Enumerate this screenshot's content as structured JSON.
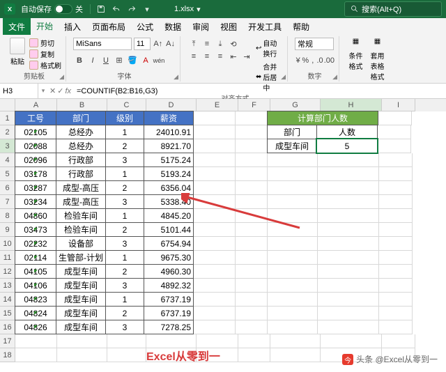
{
  "titlebar": {
    "autosave_label": "自动保存",
    "autosave_state": "关",
    "filename": "1.xlsx",
    "search_placeholder": "搜索(Alt+Q)"
  },
  "menu": {
    "file": "文件",
    "home": "开始",
    "insert": "插入",
    "layout": "页面布局",
    "formula": "公式",
    "data": "数据",
    "review": "审阅",
    "view": "视图",
    "developer": "开发工具",
    "help": "帮助"
  },
  "ribbon": {
    "paste": "粘贴",
    "cut": "剪切",
    "copy": "复制",
    "format_painter": "格式刷",
    "clipboard": "剪贴板",
    "font_name": "MiSans",
    "font_size": "11",
    "font_group": "字体",
    "align_group": "对齐方式",
    "wrap": "自动换行",
    "merge": "合并后居中",
    "number_format": "常规",
    "number_group": "数字",
    "cond_format": "条件格式",
    "table_format": "套用\n表格格式"
  },
  "cellref": {
    "name": "H3",
    "formula": "=COUNTIF(B2:B16,G3)"
  },
  "columns": [
    "A",
    "B",
    "C",
    "D",
    "E",
    "F",
    "G",
    "H",
    "I"
  ],
  "main_headers": {
    "id": "工号",
    "dept": "部门",
    "level": "级别",
    "salary": "薪资"
  },
  "side": {
    "title": "计算部门人数",
    "dept_label": "部门",
    "count_label": "人数",
    "dept_value": "成型车间",
    "count_value": "5"
  },
  "rows": [
    {
      "id": "02105",
      "dept": "总经办",
      "level": "1",
      "salary": "24010.91"
    },
    {
      "id": "02088",
      "dept": "总经办",
      "level": "2",
      "salary": "8921.70"
    },
    {
      "id": "02096",
      "dept": "行政部",
      "level": "3",
      "salary": "5175.24"
    },
    {
      "id": "03178",
      "dept": "行政部",
      "level": "1",
      "salary": "5193.24"
    },
    {
      "id": "03287",
      "dept": "成型-高压",
      "level": "2",
      "salary": "6356.04"
    },
    {
      "id": "03234",
      "dept": "成型-高压",
      "level": "3",
      "salary": "5338.40"
    },
    {
      "id": "04860",
      "dept": "检验车间",
      "level": "1",
      "salary": "4845.20"
    },
    {
      "id": "03473",
      "dept": "检验车间",
      "level": "2",
      "salary": "5101.44"
    },
    {
      "id": "02232",
      "dept": "设备部",
      "level": "3",
      "salary": "6754.94"
    },
    {
      "id": "02114",
      "dept": "生管部-计划",
      "level": "1",
      "salary": "9675.30"
    },
    {
      "id": "04105",
      "dept": "成型车间",
      "level": "2",
      "salary": "4960.30"
    },
    {
      "id": "04106",
      "dept": "成型车间",
      "level": "3",
      "salary": "4892.32"
    },
    {
      "id": "04823",
      "dept": "成型车间",
      "level": "1",
      "salary": "6737.19"
    },
    {
      "id": "04824",
      "dept": "成型车间",
      "level": "2",
      "salary": "6737.19"
    },
    {
      "id": "04826",
      "dept": "成型车间",
      "level": "3",
      "salary": "7278.25"
    }
  ],
  "watermark": "Excel从零到一",
  "footer_credit": "头条 @Excel从零到一"
}
